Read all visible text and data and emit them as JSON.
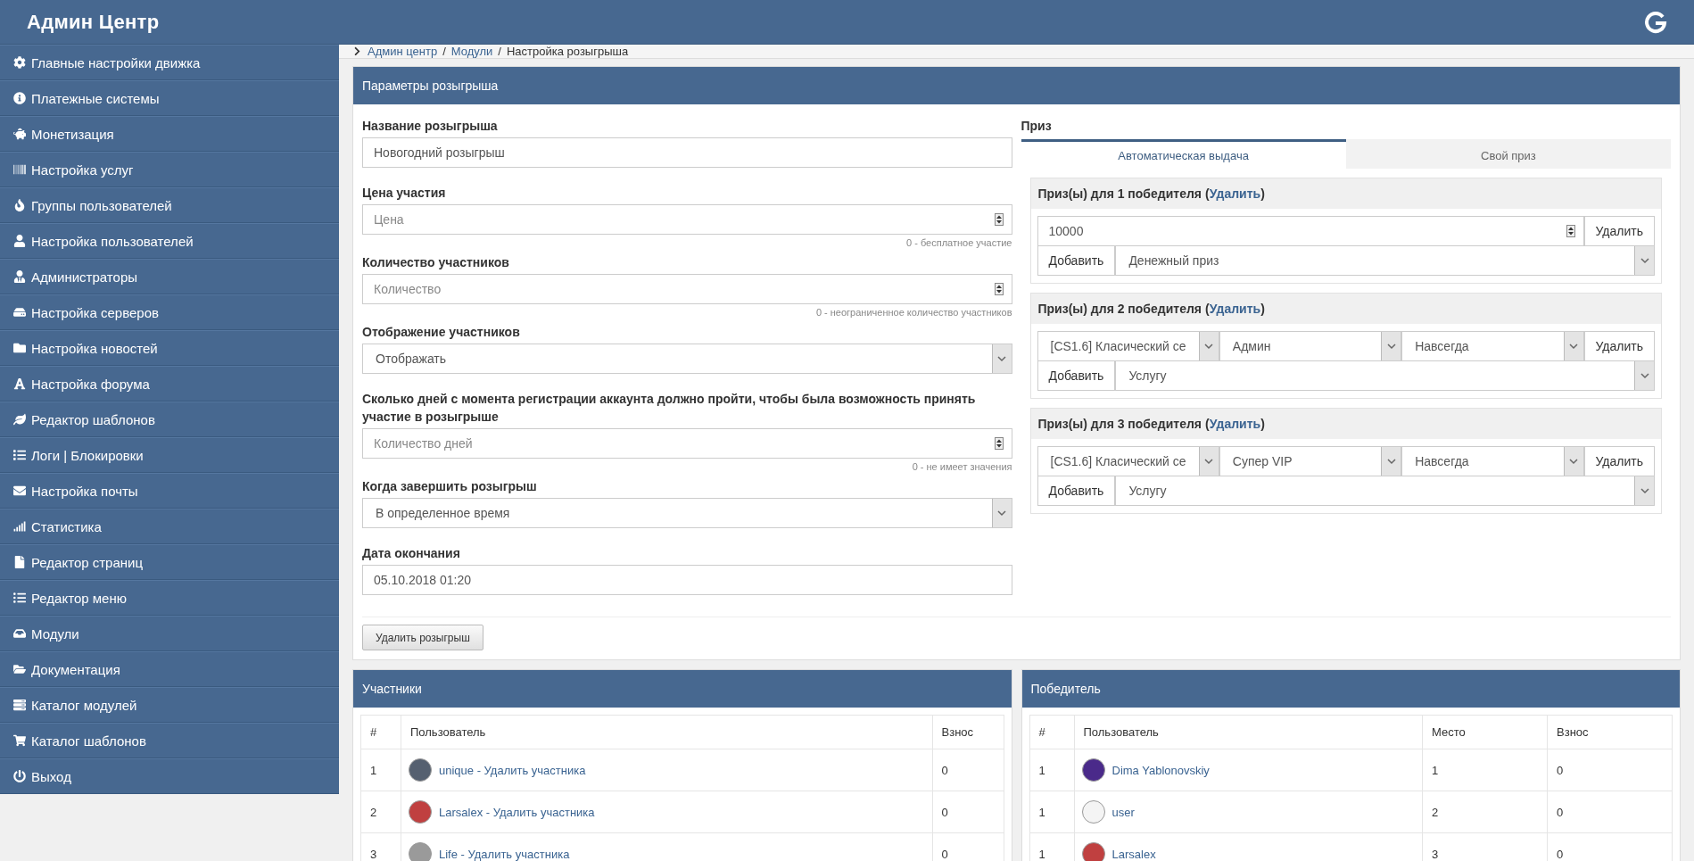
{
  "header": {
    "title": "Админ Центр"
  },
  "sidebar": {
    "items": [
      {
        "label": "Главные настройки движка"
      },
      {
        "label": "Платежные системы"
      },
      {
        "label": "Монетизация"
      },
      {
        "label": "Настройка услуг"
      },
      {
        "label": "Группы пользователей"
      },
      {
        "label": "Настройка пользователей"
      },
      {
        "label": "Администраторы"
      },
      {
        "label": "Настройка серверов"
      },
      {
        "label": "Настройка новостей"
      },
      {
        "label": "Настройка форума"
      },
      {
        "label": "Редактор шаблонов"
      },
      {
        "label": "Логи | Блокировки"
      },
      {
        "label": "Настройка почты"
      },
      {
        "label": "Статистика"
      },
      {
        "label": "Редактор страниц"
      },
      {
        "label": "Редактор меню"
      },
      {
        "label": "Модули"
      },
      {
        "label": "Документация"
      },
      {
        "label": "Каталог модулей"
      },
      {
        "label": "Каталог шаблонов"
      },
      {
        "label": "Выход"
      }
    ]
  },
  "breadcrumb": {
    "links": [
      "Админ центр",
      "Модули"
    ],
    "separators": [
      "/",
      "/"
    ],
    "current": "Настройка розыгрыша"
  },
  "settings_panel": {
    "title": "Параметры розыгрыша",
    "fields": [
      {
        "kind": "text",
        "label": "Название розыгрыша",
        "value": "Новогодний розыгрыш"
      },
      {
        "kind": "number",
        "label": "Цена участия",
        "placeholder": "Цена",
        "hint": "0 - бесплатное участие"
      },
      {
        "kind": "number",
        "label": "Количество участников",
        "placeholder": "Количество",
        "hint": "0 - неограниченное количество участников"
      },
      {
        "kind": "select",
        "label": "Отображение участников",
        "value": "Отображать"
      },
      {
        "kind": "number",
        "label": "Сколько дней с момента регистрации аккаунта должно пройти, чтобы была возможность принять участие в розыгрыше",
        "placeholder": "Количество дней",
        "hint": "0 - не имеет значения"
      },
      {
        "kind": "select",
        "label": "Когда завершить розыгрыш",
        "value": "В определенное время"
      },
      {
        "kind": "text",
        "label": "Дата окончания",
        "value": "05.10.2018 01:20"
      }
    ],
    "delete_button": "Удалить розыгрыш",
    "prize": {
      "label": "Приз",
      "tabs": [
        {
          "label": "Автоматическая выдача",
          "selected": true
        },
        {
          "label": "Свой приз",
          "selected": false
        }
      ],
      "groups": [
        {
          "kind": "money",
          "title": "Приз(ы) для 1 победителя",
          "paren_open": "(",
          "remove_link": "Удалить",
          "paren_close": ")",
          "amount": "10000",
          "remove_button": "Удалить",
          "add_button": "Добавить",
          "type": "Денежный приз"
        },
        {
          "kind": "service",
          "title": "Приз(ы) для 2 победителя",
          "paren_open": "(",
          "remove_link": "Удалить",
          "paren_close": ")",
          "server": "[CS1.6] Класический се",
          "service": "Админ",
          "term": "Навсегда",
          "remove_button": "Удалить",
          "add_button": "Добавить",
          "type": "Услугу"
        },
        {
          "kind": "service",
          "title": "Приз(ы) для 3 победителя",
          "paren_open": "(",
          "remove_link": "Удалить",
          "paren_close": ")",
          "server": "[CS1.6] Класический се",
          "service": "Супер VIP",
          "term": "Навсегда",
          "remove_button": "Удалить",
          "add_button": "Добавить",
          "type": "Услугу"
        }
      ]
    }
  },
  "participants": {
    "title": "Участники",
    "columns": [
      "#",
      "Пользователь",
      "Взнос"
    ],
    "rows": [
      {
        "num": "1",
        "user": "unique - Удалить участника",
        "fee": "0"
      },
      {
        "num": "2",
        "user": "Larsalex - Удалить участника",
        "fee": "0"
      },
      {
        "num": "3",
        "user": "Life - Удалить участника",
        "fee": "0"
      }
    ]
  },
  "winners": {
    "title": "Победитель",
    "columns": [
      "#",
      "Пользователь",
      "Место",
      "Взнос"
    ],
    "rows": [
      {
        "num": "1",
        "user": "Dima Yablonovskiy",
        "place": "1",
        "fee": "0"
      },
      {
        "num": "1",
        "user": "user",
        "place": "2",
        "fee": "0"
      },
      {
        "num": "1",
        "user": "Larsalex",
        "place": "3",
        "fee": "0"
      }
    ]
  }
}
